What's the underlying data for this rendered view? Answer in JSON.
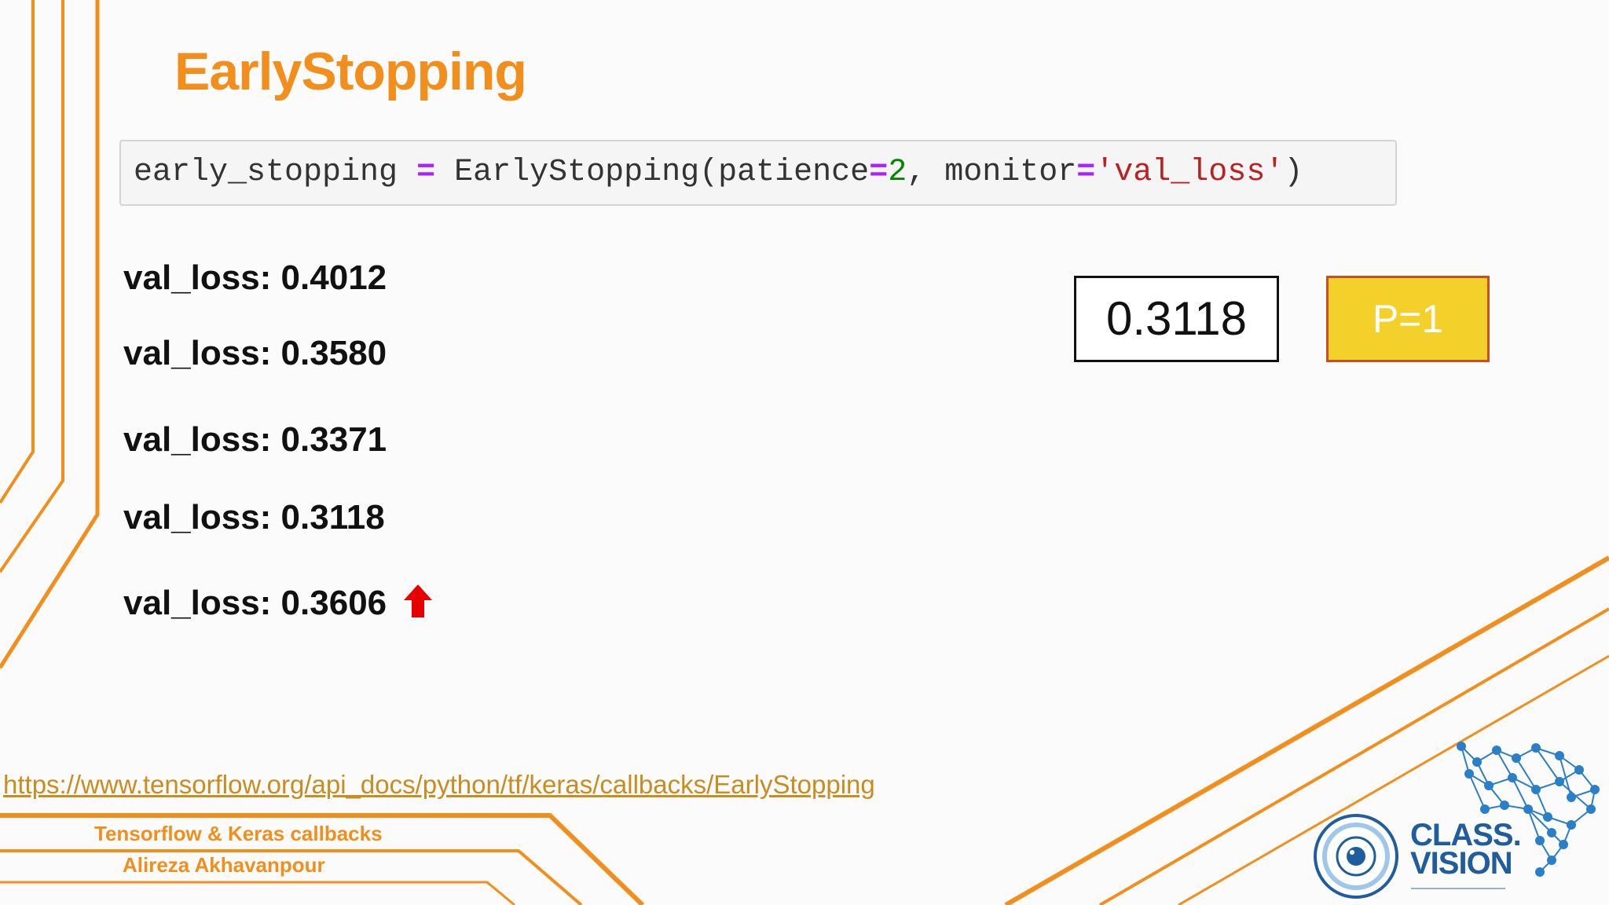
{
  "slide": {
    "title": "EarlyStopping",
    "code": {
      "var": "early_stopping ",
      "eq": "=",
      "call": " EarlyStopping",
      "open": "(",
      "arg1": "patience",
      "eq2": "=",
      "num": "2",
      "sep": ", ",
      "arg2": "monitor",
      "eq3": "=",
      "str": "'val_loss'",
      "close": ")"
    },
    "losses": [
      "val_loss: 0.4012",
      "val_loss: 0.3580",
      "val_loss: 0.3371",
      "val_loss: 0.3118",
      "val_loss: 0.3606"
    ],
    "best_value": "0.3118",
    "patience_counter": "P=1",
    "link": "https://www.tensorflow.org/api_docs/python/tf/keras/callbacks/EarlyStopping",
    "footer": {
      "course": "Tensorflow & Keras callbacks",
      "author": "Alireza Akhavanpour"
    },
    "logo": {
      "line1": "CLASS.",
      "line2": "VISION"
    }
  },
  "colors": {
    "accent": "#f28e1c",
    "code_op": "#aa22ff",
    "code_num": "#008800",
    "code_str": "#ba2121",
    "up_arrow": "#e60000",
    "patience_fill": "#f3d12a",
    "logo": "#1f5d9c"
  },
  "icons": [
    "up-arrow-icon",
    "eye-logo-icon",
    "brain-network-icon"
  ]
}
